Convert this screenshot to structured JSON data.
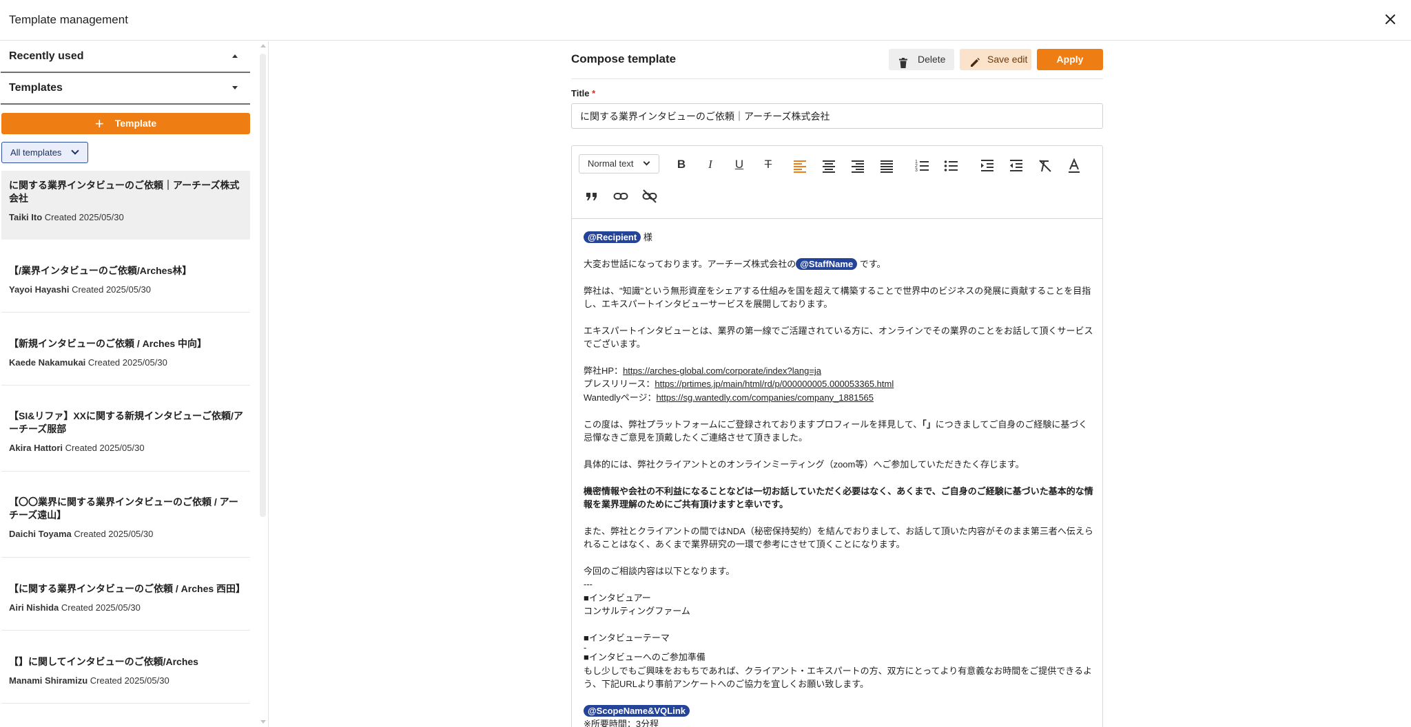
{
  "header": {
    "title": "Template management"
  },
  "sidebar": {
    "recently_used_label": "Recently used",
    "templates_label": "Templates",
    "add_template_label": "Template",
    "filter_value": "All templates",
    "templates": [
      {
        "title": "に関する業界インタビューのご依頼｜アーチーズ株式会社",
        "author": "Taiki Ito",
        "created": "Created 2025/05/30"
      },
      {
        "title": "【/業界インタビューのご依頼/Arches林】",
        "author": "Yayoi Hayashi",
        "created": "Created 2025/05/30"
      },
      {
        "title": "【新規インタビューのご依頼 / Arches 中向】",
        "author": "Kaede Nakamukai",
        "created": "Created 2025/05/30"
      },
      {
        "title": "【SI&リファ】XXに関する新規インタビューご依頼/アーチーズ服部",
        "author": "Akira Hattori",
        "created": "Created 2025/05/30"
      },
      {
        "title": "【〇〇業界に関する業界インタビューのご依頼 / アーチーズ遠山】",
        "author": "Daichi Toyama",
        "created": "Created 2025/05/30"
      },
      {
        "title": "【に関する業界インタビューのご依頼 / Arches 西田】",
        "author": "Airi Nishida",
        "created": "Created 2025/05/30"
      },
      {
        "title": "【】に関してインタビューのご依頼/Arches",
        "author": "Manami Shiramizu",
        "created": "Created 2025/05/30"
      }
    ]
  },
  "compose": {
    "heading": "Compose template",
    "delete_label": "Delete",
    "save_label": "Save edit",
    "apply_label": "Apply",
    "title_label": "Title",
    "required_mark": "*",
    "title_value": "に関する業界インタビューのご依頼｜アーチーズ株式会社"
  },
  "toolbar": {
    "text_style": "Normal text",
    "icons": [
      "bold-icon",
      "italic-icon",
      "underline-icon",
      "strikethrough-icon",
      "align-left-icon",
      "align-center-icon",
      "align-right-icon",
      "align-justify-icon",
      "ordered-list-icon",
      "bullet-list-icon",
      "indent-icon",
      "outdent-icon",
      "clear-format-icon",
      "text-color-icon",
      "quote-icon",
      "link-icon",
      "unlink-icon"
    ],
    "accent_color": "#ee7d14"
  },
  "body": {
    "chip_recipient": "@Recipient",
    "line1_suffix": " 様",
    "line2_pre": "大変お世話になっております。アーチーズ株式会社の",
    "chip_staff": "@StaffName",
    "line2_post": " です。",
    "para1": "弊社は、\"知識\"という無形資産をシェアする仕組みを国を超えて構築することで世界中のビジネスの発展に貢献することを目指し、エキスパートインタビューサービスを展開しております。",
    "para2": "エキスパートインタビューとは、業界の第一線でご活躍されている方に、オンラインでその業界のことをお話して頂くサービスでございます。",
    "hp_label": "弊社HP：",
    "hp_url": "https://arches-global.com/corporate/index?lang=ja",
    "pr_label": "プレスリリース：",
    "pr_url": "https://prtimes.jp/main/html/rd/p/000000005.000053365.html",
    "wantedly_label": "Wantedlyページ：",
    "wantedly_url": "https://sg.wantedly.com/companies/company_1881565",
    "para3_pre": "この度は、弊社プラットフォームにご登録されておりますプロフィールを拝見して、",
    "para3_mark": "「」",
    "para3_post": "につきましてご自身のご経験に基づく忌憚なきご意見を頂戴したくご連絡させて頂きました。",
    "para4": "具体的には、弊社クライアントとのオンラインミーティング（zoom等）へご参加していただきたく存じます。",
    "para5_bold": "機密情報や会社の不利益になることなどは一切お話していただく必要はなく、あくまで、ご自身のご経験に基づいた基本的な情報を業界理解のためにご共有頂けますと幸いです。",
    "para6": "また、弊社とクライアントの間ではNDA（秘密保持契約）を結んでおりまして、お話して頂いた内容がそのまま第三者へ伝えられることはなく、あくまで業界研究の一環で参考にさせて頂くことになります。",
    "para7": "今回のご相談内容は以下となります。",
    "separator": "---",
    "interviewer_head": "■インタビュアー",
    "interviewer_value": "コンサルティングファーム",
    "theme_head": "■インタビューテーマ",
    "theme_value": "-",
    "prep_head": "■インタビューへのご参加準備",
    "prep_text": "もし少しでもご興味をおもちであれば、クライアント・エキスパートの方、双方にとってより有意義なお時間をご提供できるよう、下記URLより事前アンケートへのご協力を宜しくお願い致します。",
    "chip_scope": "@ScopeName&VQLink",
    "last_line": "※所要時間：3分程"
  }
}
